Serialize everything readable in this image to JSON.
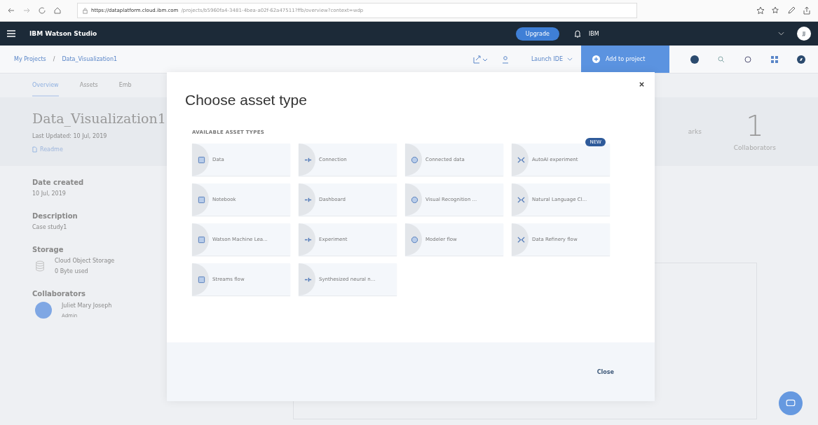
{
  "browser": {
    "url_host": "https://dataplatform.cloud.ibm.com",
    "url_path": "/projects/b5960fa4-3481-4bea-a02f-62a47511?ffb/overview?context=wdp"
  },
  "header": {
    "product": "IBM Watson Studio",
    "upgrade": "Upgrade",
    "account": "IBM",
    "avatar": "JJ"
  },
  "breadcrumb": [
    "My Projects",
    "Data_Visualization1"
  ],
  "toolbar": {
    "separator": "/",
    "launch": "Launch IDE",
    "add": "Add to project"
  },
  "tabs": [
    {
      "label": "Overview",
      "selected": true
    },
    {
      "label": "Assets",
      "selected": false
    },
    {
      "label": "Emb",
      "selected": false
    }
  ],
  "project": {
    "title": "Data_Visualization1",
    "updated": "Last Updated: 10 Jul, 2019",
    "readme": "Readme"
  },
  "stats": [
    {
      "label": "arks"
    },
    {
      "value": "1",
      "label": "Collaborators"
    }
  ],
  "details": [
    {
      "heading": "Date created",
      "value": "10 Jul, 2019"
    },
    {
      "heading": "Description",
      "value": "Case study1"
    }
  ],
  "storage": {
    "heading": "Storage",
    "name": "Cloud Object Storage",
    "used": "0 Byte used"
  },
  "collaborators": {
    "heading": "Collaborators",
    "people": [
      {
        "name": "Juliet Mary Joseph",
        "role": "Admin"
      }
    ]
  },
  "modal": {
    "title": "Choose asset type",
    "section": "AVAILABLE ASSET TYPES",
    "close": "Close",
    "assets": [
      {
        "label": "Data"
      },
      {
        "label": "Connection"
      },
      {
        "label": "Connected data"
      },
      {
        "label": "AutoAI experiment",
        "badge": "NEW"
      },
      {
        "label": "Notebook"
      },
      {
        "label": "Dashboard"
      },
      {
        "label": "Visual Recognition ..."
      },
      {
        "label": "Natural Language Cl..."
      },
      {
        "label": "Watson Machine Lea..."
      },
      {
        "label": "Experiment"
      },
      {
        "label": "Modeler flow"
      },
      {
        "label": "Data Refinery flow"
      },
      {
        "label": "Streams flow"
      },
      {
        "label": "Synthesized neural n..."
      }
    ]
  }
}
